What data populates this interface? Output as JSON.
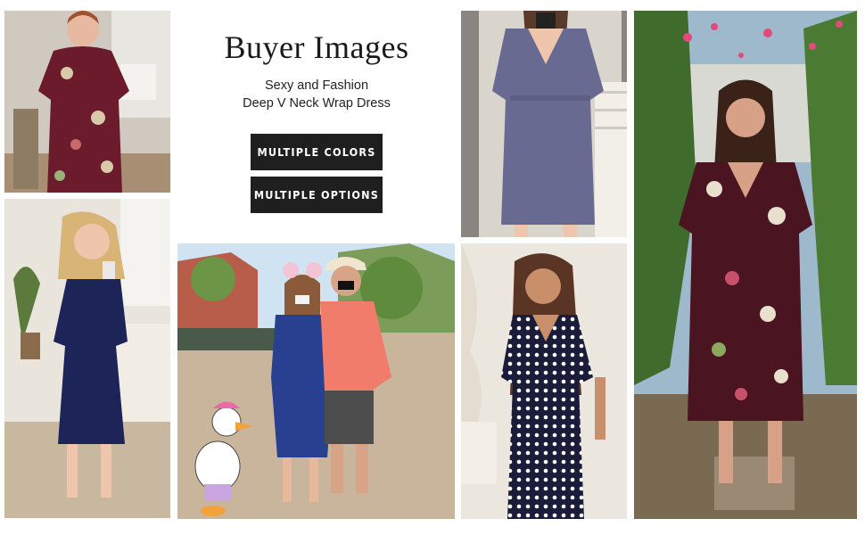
{
  "header": {
    "title": "Buyer Images",
    "subtitle_line1": "Sexy and Fashion",
    "subtitle_line2": "Deep V Neck Wrap Dress"
  },
  "buttons": {
    "multiple_colors": "MULTIPLE COLORS",
    "multiple_options": "MULTIPLE OPTIONS"
  },
  "photos": [
    {
      "name": "burgundy-floral-dress-indoor",
      "dress_color": "#6b1b2b"
    },
    {
      "name": "navy-dress-mirror-selfie",
      "dress_color": "#1d2457"
    },
    {
      "name": "navy-dress-theme-park-couple",
      "dress_color": "#28408f"
    },
    {
      "name": "lavender-gray-dress-mirror",
      "dress_color": "#686a92"
    },
    {
      "name": "polka-dot-dress-studio",
      "dress_color": "#1a1c3a"
    },
    {
      "name": "burgundy-floral-dress-garden",
      "dress_color": "#4a1420"
    }
  ]
}
